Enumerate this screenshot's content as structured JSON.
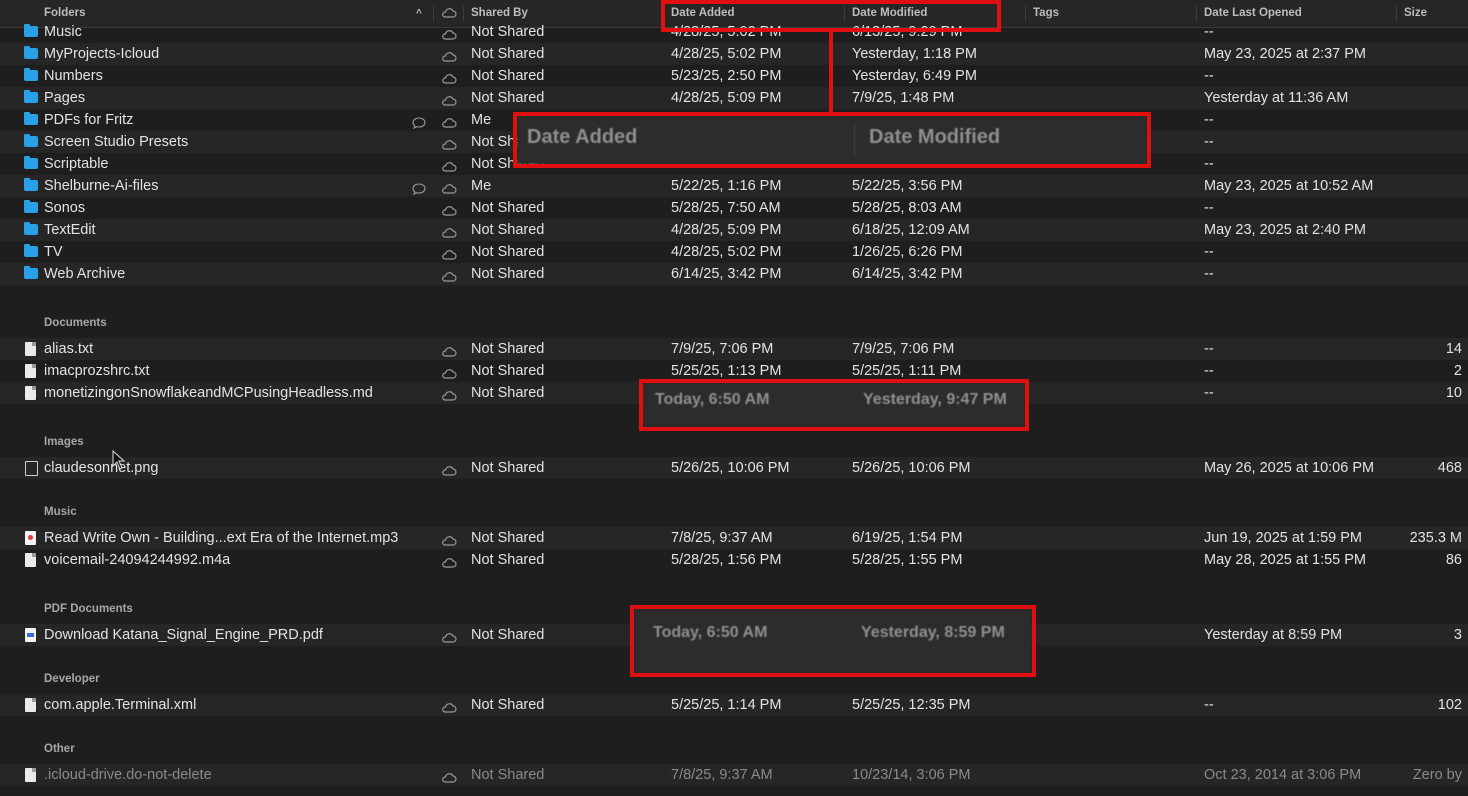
{
  "columns": {
    "folders": "Folders",
    "shared_by": "Shared By",
    "date_added": "Date Added",
    "date_modified": "Date Modified",
    "tags": "Tags",
    "date_last_opened": "Date Last Opened",
    "size": "Size"
  },
  "folder_rows": [
    {
      "name": "Music",
      "shared": "Not Shared",
      "added": "4/28/25, 5:02 PM",
      "modified": "6/13/25, 9:29 PM",
      "opened": "--",
      "size": "",
      "color": "#2aa0e8"
    },
    {
      "name": "MyProjects-Icloud",
      "shared": "Not Shared",
      "added": "4/28/25, 5:02 PM",
      "modified": "Yesterday, 1:18 PM",
      "opened": "May 23, 2025 at 2:37 PM",
      "size": "",
      "color": "#2aa0e8"
    },
    {
      "name": "Numbers",
      "shared": "Not Shared",
      "added": "5/23/25, 2:50 PM",
      "modified": "Yesterday, 6:49 PM",
      "opened": "--",
      "size": "",
      "color": "#2aa0e8"
    },
    {
      "name": "Pages",
      "shared": "Not Shared",
      "added": "4/28/25, 5:09 PM",
      "modified": "7/9/25, 1:48 PM",
      "opened": "Yesterday at 11:36 AM",
      "size": "",
      "color": "#2aa0e8"
    },
    {
      "name": "PDFs for Fritz",
      "shared": "Me",
      "added": "",
      "modified": "",
      "opened": "--",
      "size": "",
      "color": "#2aa0e8"
    },
    {
      "name": "Screen Studio Presets",
      "shared": "Not Shared",
      "added": "",
      "modified": "",
      "opened": "--",
      "size": "",
      "color": "#2aa0e8"
    },
    {
      "name": "Scriptable",
      "shared": "Not Shared",
      "added": "",
      "modified": "",
      "opened": "--",
      "size": "",
      "color": "#2aa0e8"
    },
    {
      "name": "Shelburne-Ai-files",
      "shared": "Me",
      "added": "5/22/25, 1:16 PM",
      "modified": "5/22/25, 3:56 PM",
      "opened": "May 23, 2025 at 10:52 AM",
      "size": "",
      "color": "#2aa0e8"
    },
    {
      "name": "Sonos",
      "shared": "Not Shared",
      "added": "5/28/25, 7:50 AM",
      "modified": "5/28/25, 8:03 AM",
      "opened": "--",
      "size": "",
      "color": "#2aa0e8"
    },
    {
      "name": "TextEdit",
      "shared": "Not Shared",
      "added": "4/28/25, 5:09 PM",
      "modified": "6/18/25, 12:09 AM",
      "opened": "May 23, 2025 at 2:40 PM",
      "size": "",
      "color": "#2aa0e8"
    },
    {
      "name": "TV",
      "shared": "Not Shared",
      "added": "4/28/25, 5:02 PM",
      "modified": "1/26/25, 6:26 PM",
      "opened": "--",
      "size": "",
      "color": "#2aa0e8"
    },
    {
      "name": "Web Archive",
      "shared": "Not Shared",
      "added": "6/14/25, 3:42 PM",
      "modified": "6/14/25, 3:42 PM",
      "opened": "--",
      "size": "",
      "color": "#2aa0e8"
    }
  ],
  "sections": {
    "documents": "Documents",
    "images": "Images",
    "music": "Music",
    "pdf_documents": "PDF Documents",
    "developer": "Developer",
    "other": "Other"
  },
  "documents": [
    {
      "name": "alias.txt",
      "shared": "Not Shared",
      "added": "7/9/25, 7:06 PM",
      "modified": "7/9/25, 7:06 PM",
      "opened": "--",
      "size": "14"
    },
    {
      "name": "imacprozshrc.txt",
      "shared": "Not Shared",
      "added": "5/25/25, 1:13 PM",
      "modified": "5/25/25, 1:11 PM",
      "opened": "--",
      "size": "2"
    },
    {
      "name": "monetizingonSnowflakeandMCPusingHeadless.md",
      "shared": "Not Shared",
      "added": "",
      "modified": "",
      "opened": "--",
      "size": "10"
    }
  ],
  "images": [
    {
      "name": "claudesonnet.png",
      "shared": "Not Shared",
      "added": "5/26/25, 10:06 PM",
      "modified": "5/26/25, 10:06 PM",
      "opened": "May 26, 2025 at 10:06 PM",
      "size": "468"
    }
  ],
  "music": [
    {
      "name": "Read Write Own - Building...ext Era of the Internet.mp3",
      "shared": "Not Shared",
      "added": "7/8/25, 9:37 AM",
      "modified": "6/19/25, 1:54 PM",
      "opened": "Jun 19, 2025 at 1:59 PM",
      "size": "235.3 M"
    },
    {
      "name": "voicemail-24094244992.m4a",
      "shared": "Not Shared",
      "added": "5/28/25, 1:56 PM",
      "modified": "5/28/25, 1:55 PM",
      "opened": "May 28, 2025 at 1:55 PM",
      "size": "86"
    }
  ],
  "pdfs": [
    {
      "name": "Download Katana_Signal_Engine_PRD.pdf",
      "shared": "Not Shared",
      "added": "",
      "modified": "",
      "opened": "Yesterday at 8:59 PM",
      "size": "3"
    }
  ],
  "developer": [
    {
      "name": "com.apple.Terminal.xml",
      "shared": "Not Shared",
      "added": "5/25/25, 1:14 PM",
      "modified": "5/25/25, 12:35 PM",
      "opened": "--",
      "size": "102"
    }
  ],
  "other": [
    {
      "name": ".icloud-drive.do-not-delete",
      "shared": "Not Shared",
      "added": "7/8/25, 9:37 AM",
      "modified": "10/23/14, 3:06 PM",
      "opened": "Oct 23, 2014 at 3:06 PM",
      "size": "Zero by"
    }
  ],
  "zoom_header": {
    "added": "Date Added",
    "modified": "Date Modified"
  },
  "zoom_md": {
    "added": "Today, 6:50 AM",
    "modified": "Yesterday, 9:47 PM"
  },
  "zoom_pdf": {
    "added": "Today, 6:50 AM",
    "modified": "Yesterday, 8:59 PM"
  }
}
